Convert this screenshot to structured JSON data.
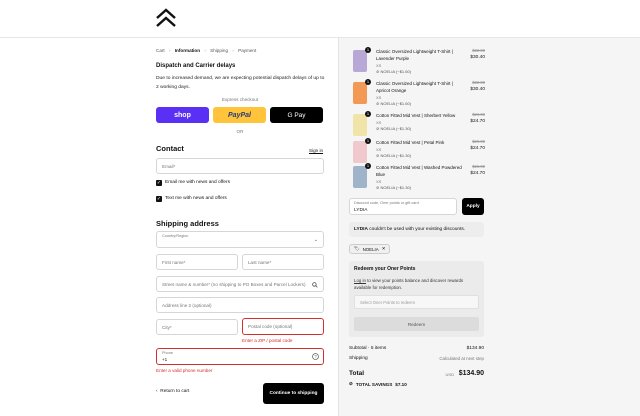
{
  "breadcrumb": {
    "cart": "Cart",
    "information": "Information",
    "shipping": "Shipping",
    "payment": "Payment",
    "sep": "›"
  },
  "notice": {
    "title": "Dispatch and Carrier delays",
    "body": "Due to increased demand, we are expecting potential dispatch delays of up to 2 working days."
  },
  "express": {
    "label": "Express checkout",
    "shop": "shop",
    "paypal": "PayPal",
    "gpay": "G Pay",
    "or": "OR"
  },
  "contact": {
    "title": "Contact",
    "sign_in": "Sign in",
    "email_placeholder": "Email*",
    "opt_email": "Email me with news and offers",
    "opt_text": "Text me with news and offers"
  },
  "shipping": {
    "title": "Shipping address",
    "country_placeholder": "Country/Region",
    "first_name": "First name*",
    "last_name": "Last name*",
    "street": "Street name & number* (no shipping to PO Boxes and Parcel Lockers)",
    "address2": "Address line 2 (optional)",
    "city": "City*",
    "postal": "Postal code (optional)",
    "postal_error": "Enter a ZIP / postal code",
    "phone_label": "Phone",
    "phone_value": "+1",
    "phone_error": "Enter a valid phone number"
  },
  "nav": {
    "return": "Return to cart",
    "continue": "Continue to shipping"
  },
  "items": [
    {
      "name": "Classic Oversized Lightweight T-Shirt | Lavender Purple",
      "variant": "XS",
      "discount": "NOELIA (−$1.60)",
      "old": "$32.00",
      "price": "$30.40",
      "qty": "1",
      "color": "#b7a8d6"
    },
    {
      "name": "Classic Oversized Lightweight T-Shirt | Apricot Orange",
      "variant": "XS",
      "discount": "NOELIA (−$1.60)",
      "old": "$32.00",
      "price": "$30.40",
      "qty": "1",
      "color": "#f29a55"
    },
    {
      "name": "Cotton Fitted Mid Vest | Sherbert Yellow",
      "variant": "XS",
      "discount": "NOELIA (−$1.30)",
      "old": "$26.00",
      "price": "$24.70",
      "qty": "1",
      "color": "#f1e4a8"
    },
    {
      "name": "Cotton Fitted Mid Vest | Petal Pink",
      "variant": "XS",
      "discount": "NOELIA (−$1.30)",
      "old": "$26.00",
      "price": "$24.70",
      "qty": "1",
      "color": "#f0c9cf"
    },
    {
      "name": "Cotton Fitted Mid Vest | Washed Powdered Blue",
      "variant": "XS",
      "discount": "NOELIA (−$1.30)",
      "old": "$26.00",
      "price": "$24.70",
      "qty": "1",
      "color": "#9fb4c9"
    }
  ],
  "discount": {
    "label": "Discount code, Oner points or gift card",
    "value": "LYDIA",
    "apply": "Apply",
    "msg_code": "LYDIA",
    "msg_rest": " couldn't be used with your existing discounts.",
    "tag": "NOELIA"
  },
  "redeem": {
    "title": "Redeem your Oner Points",
    "link": "Log in",
    "body_rest": " to view your points balance and discover rewards available for redemption.",
    "select_placeholder": "Select Oner Points to redeem",
    "button": "Redeem"
  },
  "summary": {
    "subtotal_label": "Subtotal · 5 items",
    "subtotal": "$134.90",
    "shipping_label": "Shipping",
    "shipping": "Calculated at next step",
    "total_label": "Total",
    "currency": "USD",
    "total": "$134.90",
    "savings_label": "TOTAL SAVINGS",
    "savings": "$7.10"
  }
}
